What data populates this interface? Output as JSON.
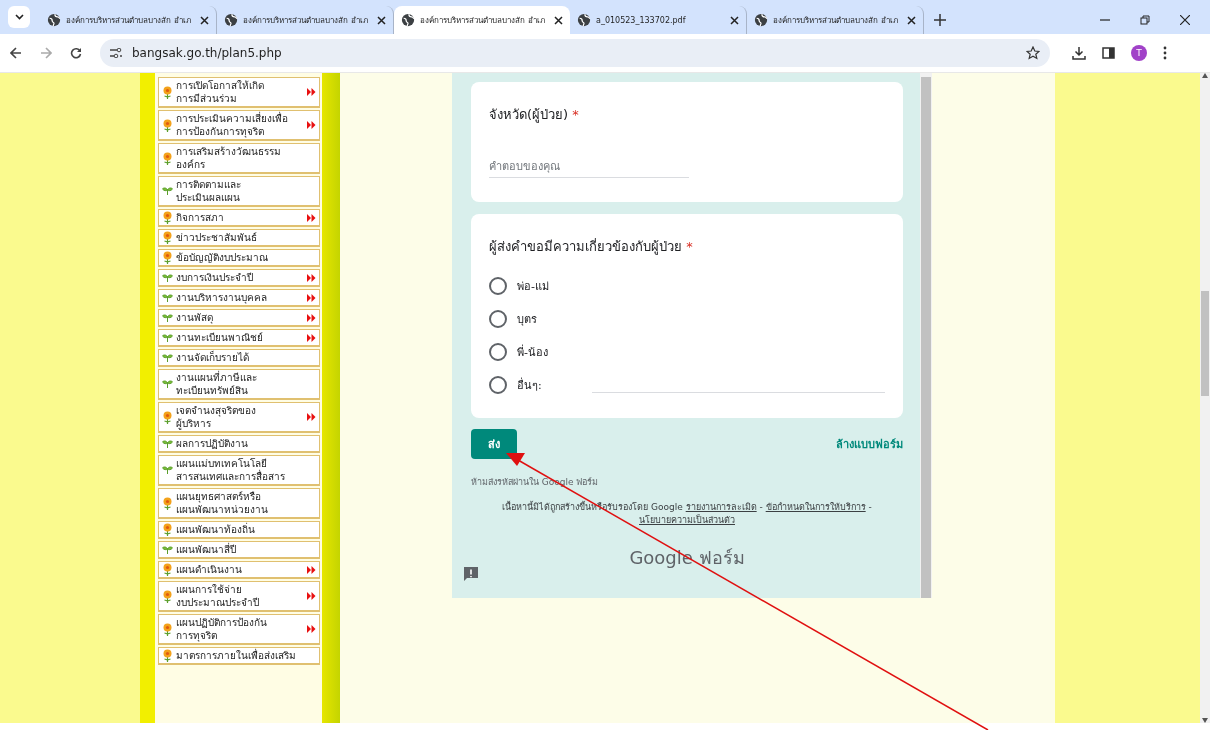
{
  "browser": {
    "tabs": [
      {
        "title": "องค์การบริหารส่วนตำบลบางสัก อำเภ",
        "kind": "web",
        "selected": false
      },
      {
        "title": "องค์การบริหารส่วนตำบลบางสัก อำเภ",
        "kind": "web",
        "selected": false
      },
      {
        "title": "องค์การบริหารส่วนตำบลบางสัก อำเภ",
        "kind": "web",
        "selected": true
      },
      {
        "title": "a_010523_133702.pdf",
        "kind": "web",
        "selected": false
      },
      {
        "title": "องค์การบริหารส่วนตำบลบางสัก อำเภ",
        "kind": "web",
        "selected": false
      }
    ],
    "url": "bangsak.go.th/plan5.php",
    "profile_initial": "T"
  },
  "sidebar": {
    "items": [
      {
        "label": "การเปิดโอกาสให้เกิด\nการมีส่วนร่วม",
        "kind": "flower",
        "submenu": true
      },
      {
        "label": "การประเมินความเสี่ยงเพื่อ\nการป้องกันการทุจริต",
        "kind": "flower",
        "submenu": true
      },
      {
        "label": "การเสริมสร้างวัฒนธรรม\nองค์กร",
        "kind": "flower",
        "submenu": false
      },
      {
        "label": "การติดตามและ\nประเมินผลแผน",
        "kind": "sprout",
        "submenu": false
      },
      {
        "label": "กิจการสภา",
        "kind": "flower",
        "submenu": true
      },
      {
        "label": "ข่าวประชาสัมพันธ์",
        "kind": "flower",
        "submenu": false
      },
      {
        "label": "ข้อบัญญัติงบประมาณ",
        "kind": "flower",
        "submenu": false
      },
      {
        "label": "งบการเงินประจำปี",
        "kind": "sprout",
        "submenu": true
      },
      {
        "label": "งานบริหารงานบุคคล",
        "kind": "sprout",
        "submenu": true
      },
      {
        "label": "งานพัสดุ",
        "kind": "sprout",
        "submenu": true
      },
      {
        "label": "งานทะเบียนพาณิชย์",
        "kind": "sprout",
        "submenu": true
      },
      {
        "label": "งานจัดเก็บรายได้",
        "kind": "sprout",
        "submenu": false
      },
      {
        "label": "งานแผนที่ภาษีและ\nทะเบียนทรัพย์สิน",
        "kind": "sprout",
        "submenu": false
      },
      {
        "label": "เจตจำนงสุจริตของ\nผู้บริหาร",
        "kind": "flower",
        "submenu": true
      },
      {
        "label": "ผลการปฏิบัติงาน",
        "kind": "sprout",
        "submenu": false
      },
      {
        "label": "แผนแม่บทเทคโนโลยี\nสารสนเทศและการสื่อสาร",
        "kind": "sprout",
        "submenu": false
      },
      {
        "label": "แผนยุทธศาสตร์หรือ\nแผนพัฒนาหน่วยงาน",
        "kind": "flower",
        "submenu": false
      },
      {
        "label": "แผนพัฒนาท้องถิ่น",
        "kind": "flower",
        "submenu": false
      },
      {
        "label": "แผนพัฒนาสี่ปี",
        "kind": "sprout",
        "submenu": false
      },
      {
        "label": "แผนดำเนินงาน",
        "kind": "flower",
        "submenu": true
      },
      {
        "label": "แผนการใช้จ่าย\nงบประมาณประจำปี",
        "kind": "flower",
        "submenu": true
      },
      {
        "label": "แผนปฏิบัติการป้องกัน\nการทุจริต",
        "kind": "flower",
        "submenu": true
      },
      {
        "label": "มาตรการภายในเพื่อส่งเสริม",
        "kind": "flower",
        "submenu": false
      }
    ]
  },
  "form": {
    "questions": [
      {
        "title": "จังหวัด(ผู้ป่วย)",
        "required": true,
        "kind": "text",
        "placeholder": "คำตอบของคุณ"
      },
      {
        "title": "ผู้ส่งคำขอมีความเกี่ยวข้องกับผู้ป่วย",
        "required": true,
        "kind": "radio",
        "options": [
          {
            "label": "พ่อ-แม่",
            "selected": false,
            "kind": "plain"
          },
          {
            "label": "บุตร",
            "selected": false,
            "kind": "plain"
          },
          {
            "label": "พี่-น้อง",
            "selected": false,
            "kind": "plain"
          },
          {
            "label": "อื่นๆ:",
            "selected": false,
            "kind": "other"
          }
        ]
      }
    ],
    "submit": "ส่ง",
    "required_mark": "*",
    "clear": "ล้างแบบฟอร์ม",
    "warning": "ห้ามส่งรหัสผ่านใน Google ฟอร์ม",
    "disclaimer": "เนื้อหานี้มิได้ถูกสร้างขึ้นหรือรับรองโดย Google",
    "links": [
      "รายงานการละเมิด",
      "ข้อกำหนดในการให้บริการ",
      "นโยบายความเป็นส่วนตัว"
    ],
    "separator": "-",
    "logo": {
      "brand": "Google",
      "product": "ฟอร์ม"
    }
  }
}
